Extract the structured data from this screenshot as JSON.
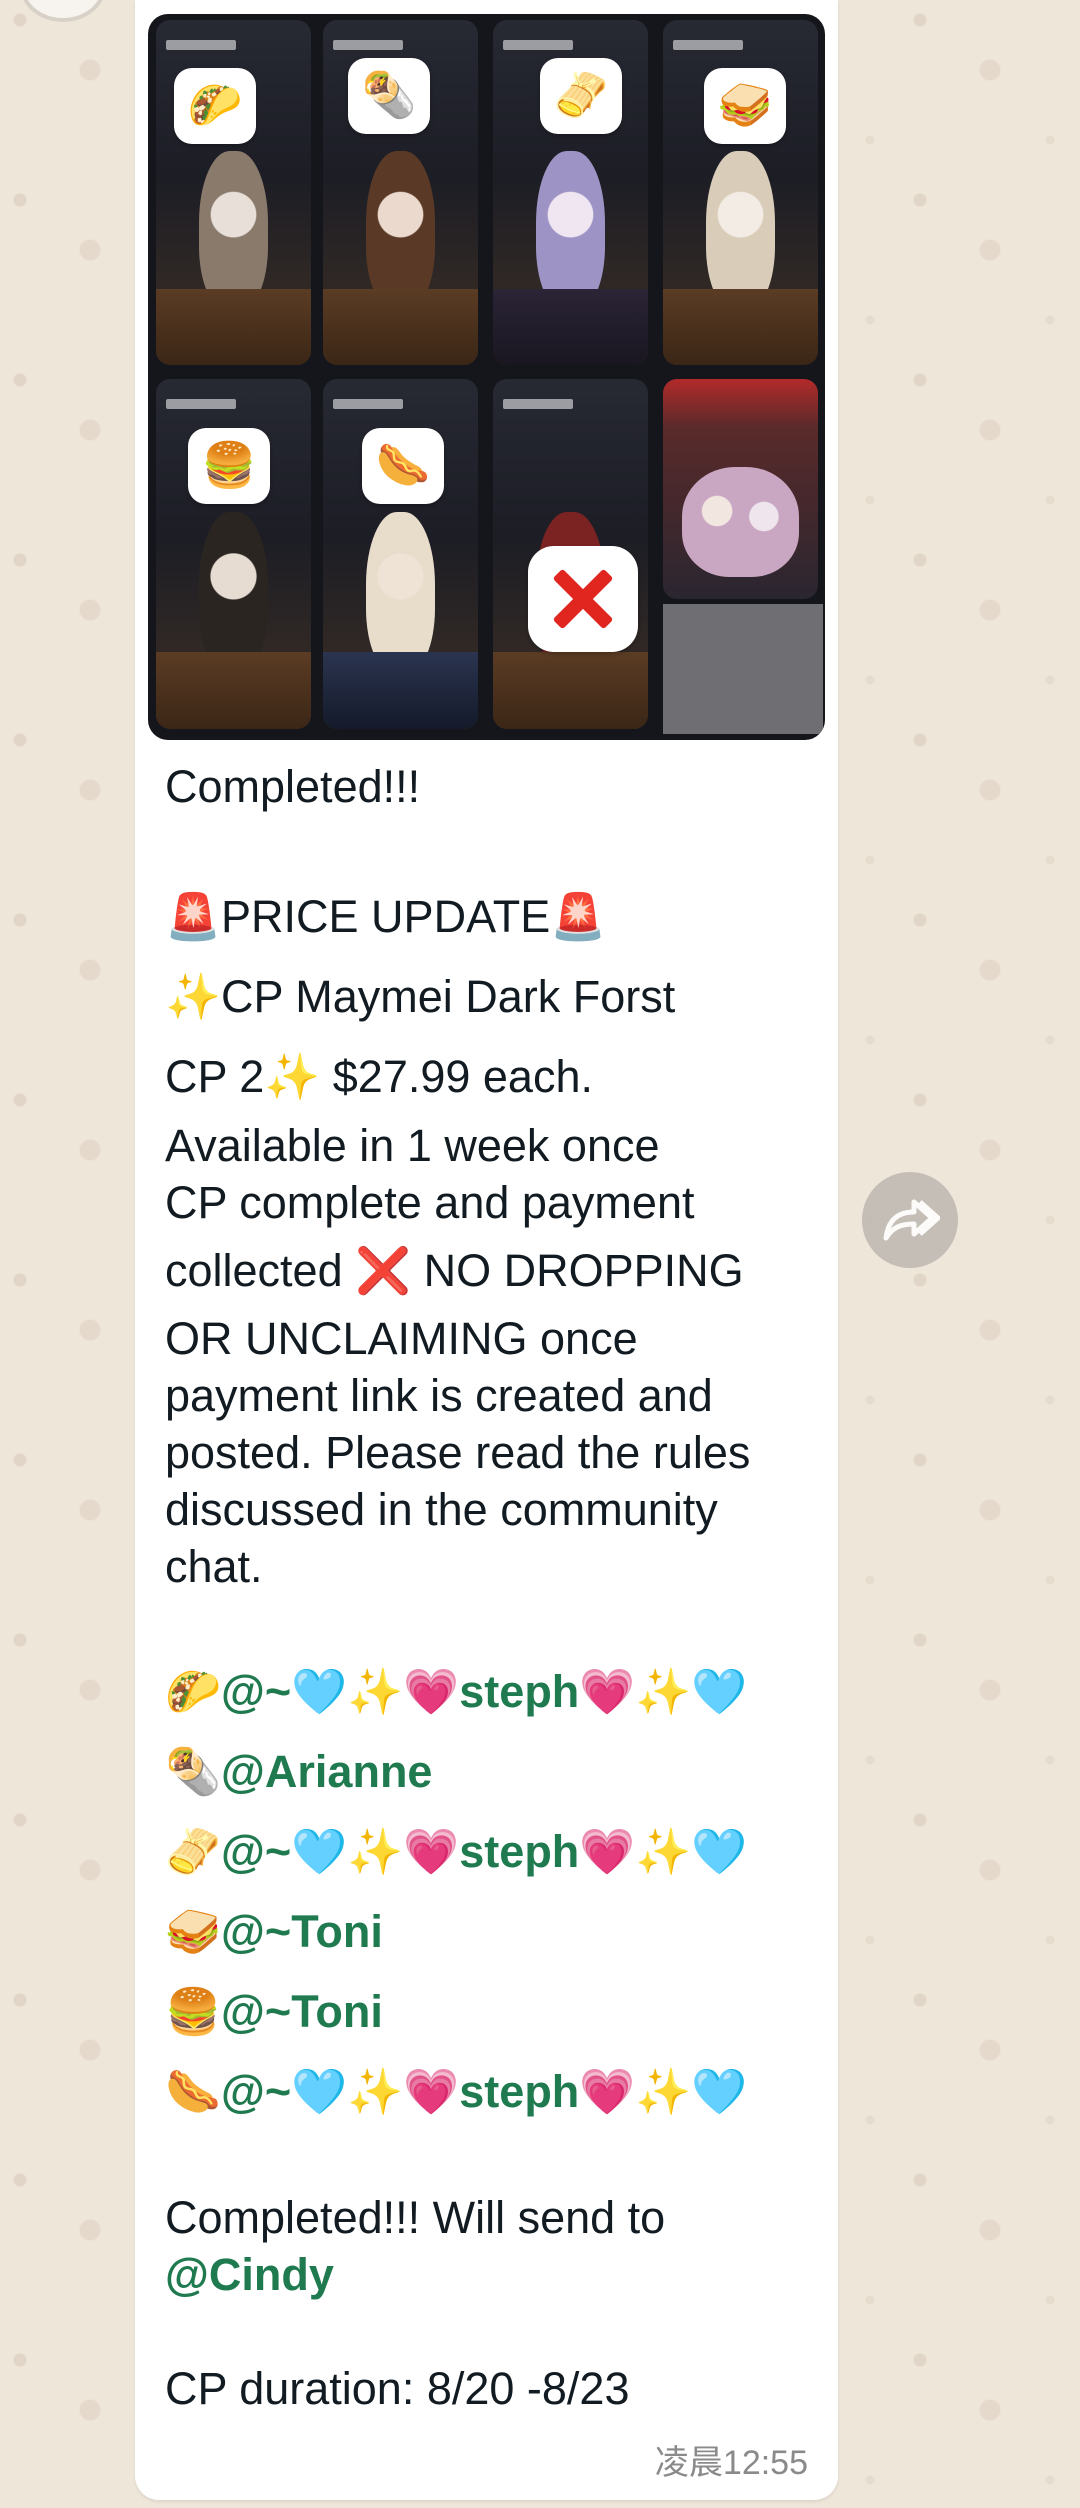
{
  "message": {
    "media_stickers": [
      "🌮",
      "🌯",
      "🫔",
      "🥪",
      "🍔",
      "🌭"
    ],
    "lines": [
      "Completed!!!",
      "🚨PRICE UPDATE🚨",
      "✨CP Maymei Dark Forst",
      "CP 2✨ $27.99 each.",
      "Available in 1 week once",
      "CP complete and payment",
      "collected ❌ NO DROPPING",
      "OR UNCLAIMING once",
      "payment link is created and",
      "posted. Please read the rules",
      "discussed in the community",
      "chat."
    ],
    "claims": [
      {
        "emoji": "🌮",
        "mention": "@~🩵✨💗steph💗✨🩵"
      },
      {
        "emoji": "🌯",
        "mention": "@Arianne"
      },
      {
        "emoji": "🫔",
        "mention": "@~🩵✨💗steph💗✨🩵"
      },
      {
        "emoji": "🥪",
        "mention": "@~Toni"
      },
      {
        "emoji": "🍔",
        "mention": "@~Toni"
      },
      {
        "emoji": "🌭",
        "mention": "@~🩵✨💗steph💗✨🩵"
      }
    ],
    "completed_note": "Completed!!! Will send to",
    "completed_mention": "@Cindy",
    "duration": "CP duration: 8/20 -8/23",
    "timestamp": "凌晨12:55"
  },
  "colors": {
    "mention": "#1f7a4f",
    "bubble": "#ffffff",
    "wallpaper": "#efe6da"
  }
}
